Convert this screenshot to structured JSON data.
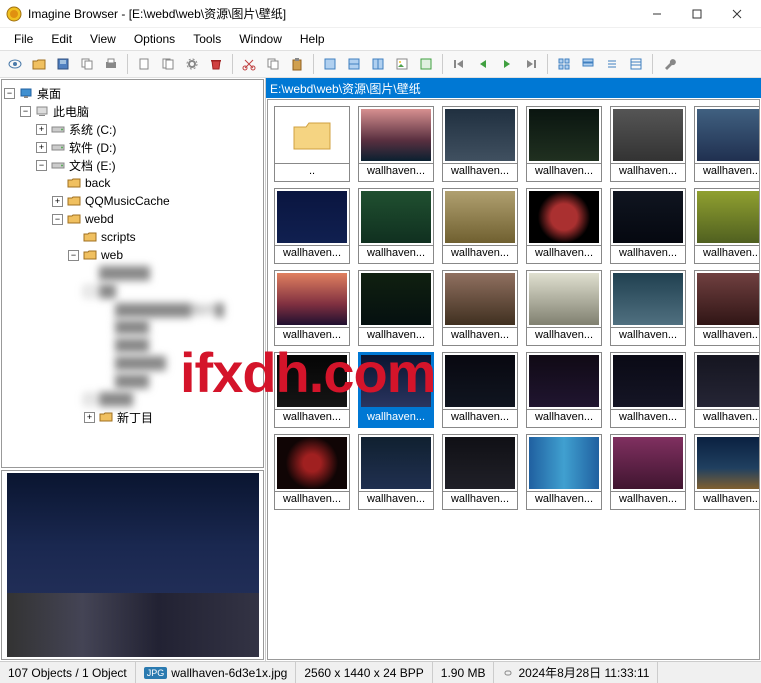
{
  "window": {
    "title": "Imagine Browser - [E:\\webd\\web\\资源\\图片\\壁纸]"
  },
  "menu": {
    "file": "File",
    "edit": "Edit",
    "view": "View",
    "options": "Options",
    "tools": "Tools",
    "window": "Window",
    "help": "Help"
  },
  "tree": {
    "root": "桌面",
    "this_pc": "此电脑",
    "drive_c": "系统 (C:)",
    "drive_d": "软件 (D:)",
    "drive_e": "文档 (E:)",
    "back": "back",
    "qqmusic": "QQMusicCache",
    "webd": "webd",
    "scripts": "scripts",
    "web": "web",
    "new_item": "新丁目"
  },
  "path": "E:\\webd\\web\\资源\\图片\\壁纸",
  "thumbs": [
    {
      "label": "..",
      "type": "folder"
    },
    {
      "label": "wallhaven...",
      "bg": "linear-gradient(180deg,#d79090 0%,#5a3040 60%,#0a2030 100%)"
    },
    {
      "label": "wallhaven...",
      "bg": "linear-gradient(180deg,#203040 0%,#405060 100%)"
    },
    {
      "label": "wallhaven...",
      "bg": "linear-gradient(180deg,#0a1510 0%,#203020 100%)"
    },
    {
      "label": "wallhaven...",
      "bg": "linear-gradient(180deg,#555 0%,#333 100%)"
    },
    {
      "label": "wallhaven...",
      "bg": "linear-gradient(180deg,#406080 0%,#203050 100%)"
    },
    {
      "label": "wallhaven...",
      "bg": "linear-gradient(180deg,#0a1540 0%,#102050 100%)"
    },
    {
      "label": "wallhaven...",
      "bg": "linear-gradient(180deg,#205030 0%,#103020 100%)"
    },
    {
      "label": "wallhaven...",
      "bg": "linear-gradient(180deg,#b0a070 0%,#706030 100%)"
    },
    {
      "label": "wallhaven...",
      "bg": "radial-gradient(circle,#aa3030 30%,#000 60%)"
    },
    {
      "label": "wallhaven...",
      "bg": "linear-gradient(180deg,#101520 0%,#050810 100%)"
    },
    {
      "label": "wallhaven...",
      "bg": "linear-gradient(180deg,#90a030 0%,#506020 100%)"
    },
    {
      "label": "wallhaven...",
      "bg": "linear-gradient(180deg,#e08060 0%,#803040 60%,#201030 100%)"
    },
    {
      "label": "wallhaven...",
      "bg": "linear-gradient(180deg,#102010 0%,#051010 100%)"
    },
    {
      "label": "wallhaven...",
      "bg": "linear-gradient(180deg,#907060 0%,#403020 100%)"
    },
    {
      "label": "wallhaven...",
      "bg": "linear-gradient(180deg,#e0e0d0 0%,#808070 100%)"
    },
    {
      "label": "wallhaven...",
      "bg": "linear-gradient(180deg,#204050 0%,#507080 100%)"
    },
    {
      "label": "wallhaven...",
      "bg": "linear-gradient(180deg,#704040 0%,#301515 100%)"
    },
    {
      "label": "wallhaven...",
      "bg": "linear-gradient(180deg,#050505 0%,#151515 100%)"
    },
    {
      "label": "wallhaven...",
      "bg": "linear-gradient(180deg,#0a1530 0%,#2a3560 100%)",
      "selected": true
    },
    {
      "label": "wallhaven...",
      "bg": "linear-gradient(180deg,#080810 0%,#101520 100%)"
    },
    {
      "label": "wallhaven...",
      "bg": "linear-gradient(180deg,#100a15 0%,#201530 100%)"
    },
    {
      "label": "wallhaven...",
      "bg": "linear-gradient(180deg,#0a0a15 0%,#151525 100%)"
    },
    {
      "label": "wallhaven...",
      "bg": "linear-gradient(180deg,#151520 0%,#252535 100%)"
    },
    {
      "label": "wallhaven...",
      "bg": "radial-gradient(circle,#a02020 20%,#100505 60%)"
    },
    {
      "label": "wallhaven...",
      "bg": "linear-gradient(180deg,#102030 0%,#203050 100%)"
    },
    {
      "label": "wallhaven...",
      "bg": "linear-gradient(180deg,#101015 0%,#202028 100%)"
    },
    {
      "label": "wallhaven...",
      "bg": "linear-gradient(90deg,#2060a0 0%,#40a0d0 50%,#2060a0 100%)"
    },
    {
      "label": "wallhaven...",
      "bg": "linear-gradient(180deg,#803060 0%,#401530 100%)"
    },
    {
      "label": "wallhaven...",
      "bg": "linear-gradient(180deg,#0a2040 0%,#204060 60%,#806030 100%)"
    }
  ],
  "status": {
    "objects": "107 Objects / 1 Object",
    "badge": "JPG",
    "filename": "wallhaven-6d3e1x.jpg",
    "dimensions": "2560 x 1440 x 24 BPP",
    "filesize": "1.90 MB",
    "datetime": "2024年8月28日 11:33:11"
  },
  "watermark": "ifxdh.com"
}
